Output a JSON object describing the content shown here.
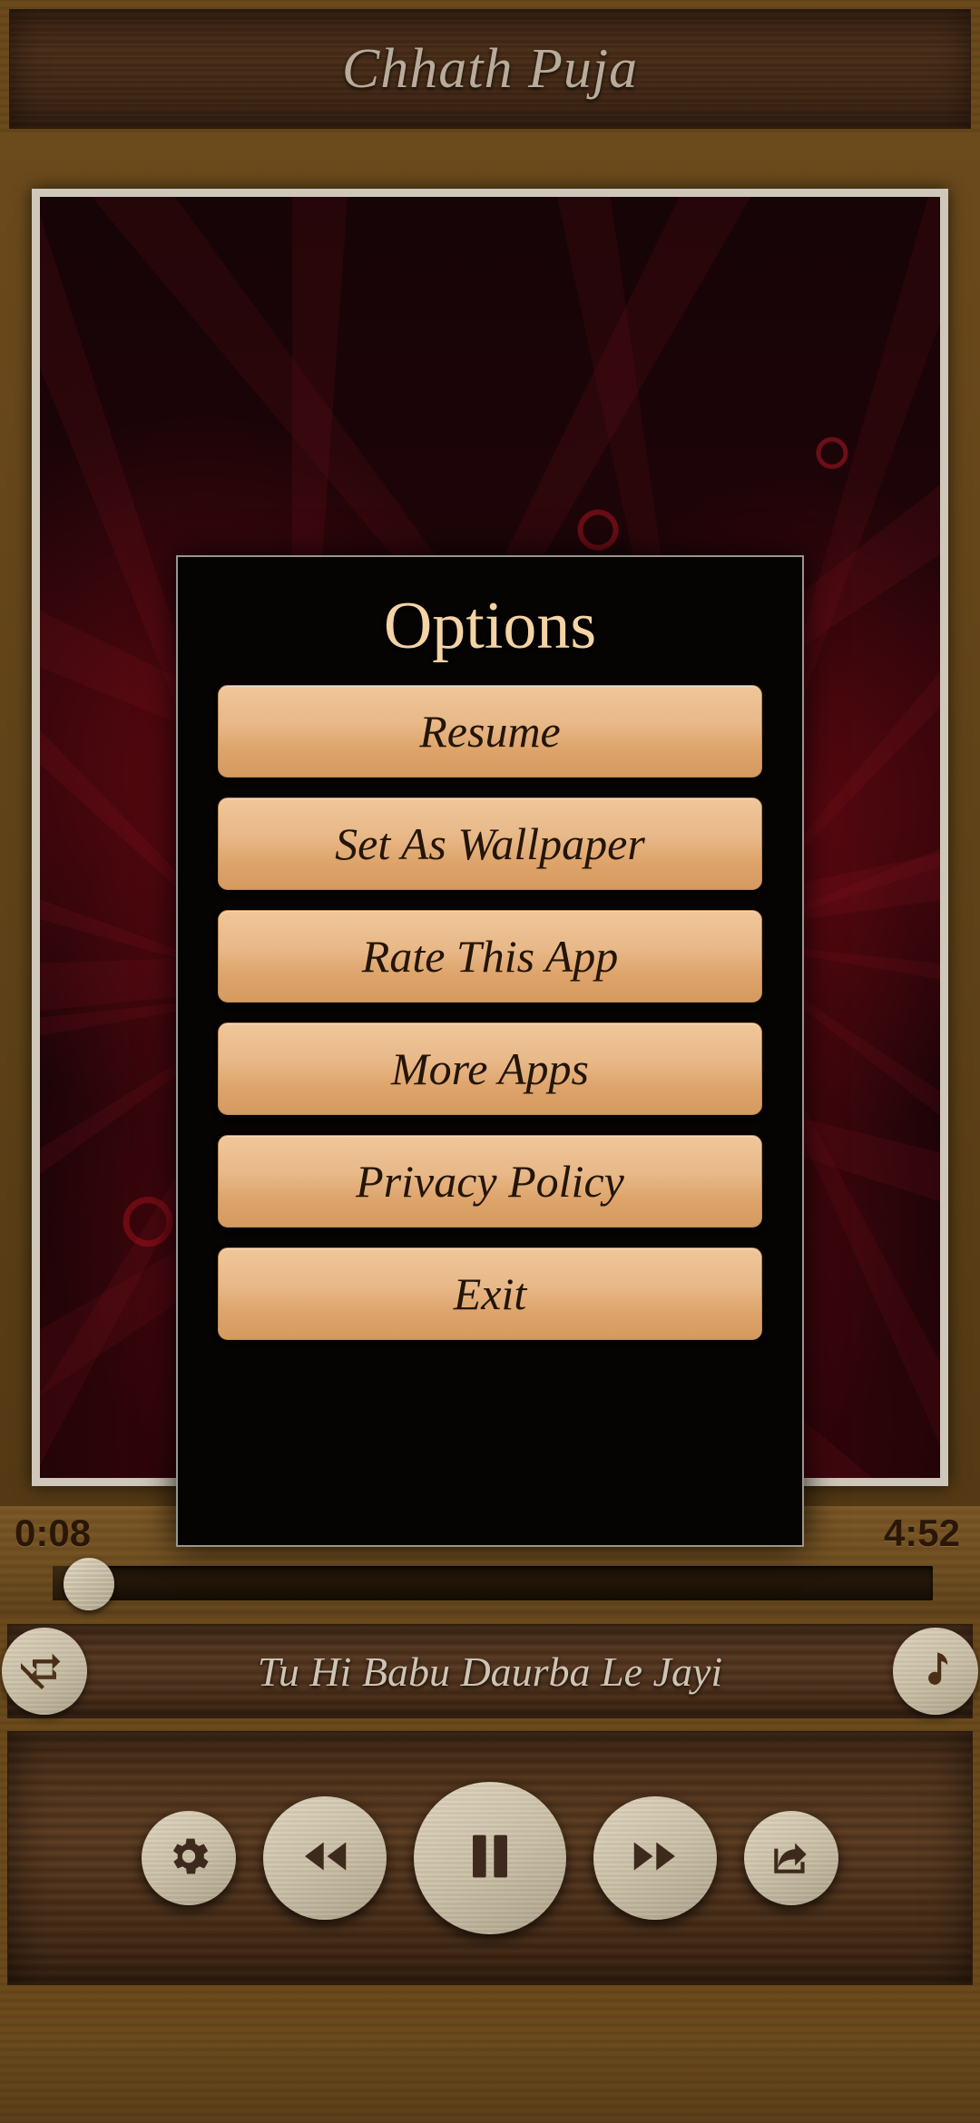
{
  "app": {
    "title": "Chhath Puja"
  },
  "dialog": {
    "title": "Options",
    "buttons": [
      {
        "id": "resume",
        "label": "Resume"
      },
      {
        "id": "set-wallpaper",
        "label": "Set As Wallpaper"
      },
      {
        "id": "rate-app",
        "label": "Rate This App"
      },
      {
        "id": "more-apps",
        "label": "More Apps"
      },
      {
        "id": "privacy",
        "label": "Privacy Policy"
      },
      {
        "id": "exit",
        "label": "Exit"
      }
    ]
  },
  "player": {
    "current_time": "0:08",
    "total_time": "4:52",
    "progress_percent": 2.7,
    "song_title": "Tu Hi Babu Daurba Le Jayi",
    "repeat_icon": "repeat-off-icon",
    "playlist_icon": "music-note-icon",
    "controls": [
      {
        "id": "settings",
        "icon": "gear-icon"
      },
      {
        "id": "previous",
        "icon": "rewind-icon"
      },
      {
        "id": "playpause",
        "icon": "pause-icon"
      },
      {
        "id": "next",
        "icon": "fast-forward-icon"
      },
      {
        "id": "share",
        "icon": "share-icon"
      }
    ]
  },
  "colors": {
    "wood_dark": "#3d2414",
    "wood_mid": "#6b4a1c",
    "button_tan": "#e8b888",
    "title_text": "#b8ab99",
    "dialog_title": "#f4d3a4",
    "wallpaper_red": "#c8142"
  }
}
